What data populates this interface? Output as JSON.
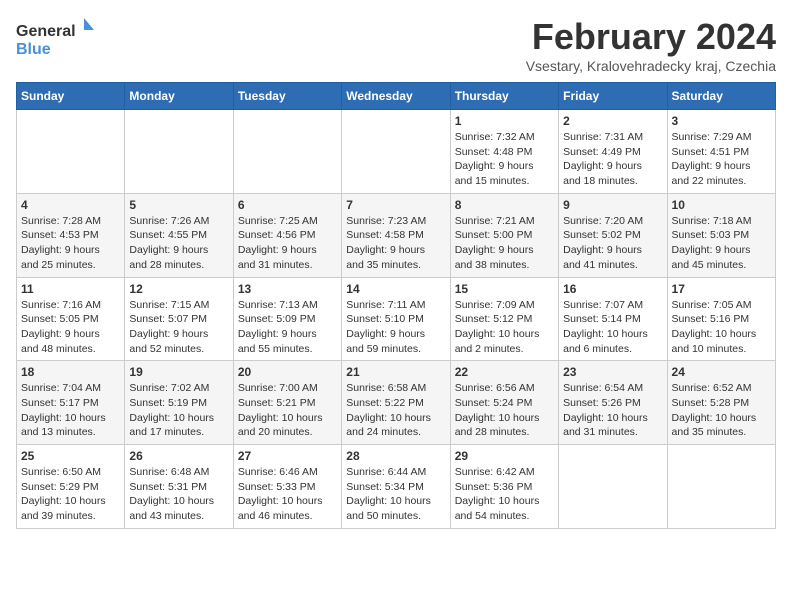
{
  "logo": {
    "line1": "General",
    "line2": "Blue"
  },
  "title": "February 2024",
  "subtitle": "Vsestary, Kralovehradecky kraj, Czechia",
  "days_of_week": [
    "Sunday",
    "Monday",
    "Tuesday",
    "Wednesday",
    "Thursday",
    "Friday",
    "Saturday"
  ],
  "weeks": [
    [
      {
        "day": "",
        "info": ""
      },
      {
        "day": "",
        "info": ""
      },
      {
        "day": "",
        "info": ""
      },
      {
        "day": "",
        "info": ""
      },
      {
        "day": "1",
        "info": "Sunrise: 7:32 AM\nSunset: 4:48 PM\nDaylight: 9 hours\nand 15 minutes."
      },
      {
        "day": "2",
        "info": "Sunrise: 7:31 AM\nSunset: 4:49 PM\nDaylight: 9 hours\nand 18 minutes."
      },
      {
        "day": "3",
        "info": "Sunrise: 7:29 AM\nSunset: 4:51 PM\nDaylight: 9 hours\nand 22 minutes."
      }
    ],
    [
      {
        "day": "4",
        "info": "Sunrise: 7:28 AM\nSunset: 4:53 PM\nDaylight: 9 hours\nand 25 minutes."
      },
      {
        "day": "5",
        "info": "Sunrise: 7:26 AM\nSunset: 4:55 PM\nDaylight: 9 hours\nand 28 minutes."
      },
      {
        "day": "6",
        "info": "Sunrise: 7:25 AM\nSunset: 4:56 PM\nDaylight: 9 hours\nand 31 minutes."
      },
      {
        "day": "7",
        "info": "Sunrise: 7:23 AM\nSunset: 4:58 PM\nDaylight: 9 hours\nand 35 minutes."
      },
      {
        "day": "8",
        "info": "Sunrise: 7:21 AM\nSunset: 5:00 PM\nDaylight: 9 hours\nand 38 minutes."
      },
      {
        "day": "9",
        "info": "Sunrise: 7:20 AM\nSunset: 5:02 PM\nDaylight: 9 hours\nand 41 minutes."
      },
      {
        "day": "10",
        "info": "Sunrise: 7:18 AM\nSunset: 5:03 PM\nDaylight: 9 hours\nand 45 minutes."
      }
    ],
    [
      {
        "day": "11",
        "info": "Sunrise: 7:16 AM\nSunset: 5:05 PM\nDaylight: 9 hours\nand 48 minutes."
      },
      {
        "day": "12",
        "info": "Sunrise: 7:15 AM\nSunset: 5:07 PM\nDaylight: 9 hours\nand 52 minutes."
      },
      {
        "day": "13",
        "info": "Sunrise: 7:13 AM\nSunset: 5:09 PM\nDaylight: 9 hours\nand 55 minutes."
      },
      {
        "day": "14",
        "info": "Sunrise: 7:11 AM\nSunset: 5:10 PM\nDaylight: 9 hours\nand 59 minutes."
      },
      {
        "day": "15",
        "info": "Sunrise: 7:09 AM\nSunset: 5:12 PM\nDaylight: 10 hours\nand 2 minutes."
      },
      {
        "day": "16",
        "info": "Sunrise: 7:07 AM\nSunset: 5:14 PM\nDaylight: 10 hours\nand 6 minutes."
      },
      {
        "day": "17",
        "info": "Sunrise: 7:05 AM\nSunset: 5:16 PM\nDaylight: 10 hours\nand 10 minutes."
      }
    ],
    [
      {
        "day": "18",
        "info": "Sunrise: 7:04 AM\nSunset: 5:17 PM\nDaylight: 10 hours\nand 13 minutes."
      },
      {
        "day": "19",
        "info": "Sunrise: 7:02 AM\nSunset: 5:19 PM\nDaylight: 10 hours\nand 17 minutes."
      },
      {
        "day": "20",
        "info": "Sunrise: 7:00 AM\nSunset: 5:21 PM\nDaylight: 10 hours\nand 20 minutes."
      },
      {
        "day": "21",
        "info": "Sunrise: 6:58 AM\nSunset: 5:22 PM\nDaylight: 10 hours\nand 24 minutes."
      },
      {
        "day": "22",
        "info": "Sunrise: 6:56 AM\nSunset: 5:24 PM\nDaylight: 10 hours\nand 28 minutes."
      },
      {
        "day": "23",
        "info": "Sunrise: 6:54 AM\nSunset: 5:26 PM\nDaylight: 10 hours\nand 31 minutes."
      },
      {
        "day": "24",
        "info": "Sunrise: 6:52 AM\nSunset: 5:28 PM\nDaylight: 10 hours\nand 35 minutes."
      }
    ],
    [
      {
        "day": "25",
        "info": "Sunrise: 6:50 AM\nSunset: 5:29 PM\nDaylight: 10 hours\nand 39 minutes."
      },
      {
        "day": "26",
        "info": "Sunrise: 6:48 AM\nSunset: 5:31 PM\nDaylight: 10 hours\nand 43 minutes."
      },
      {
        "day": "27",
        "info": "Sunrise: 6:46 AM\nSunset: 5:33 PM\nDaylight: 10 hours\nand 46 minutes."
      },
      {
        "day": "28",
        "info": "Sunrise: 6:44 AM\nSunset: 5:34 PM\nDaylight: 10 hours\nand 50 minutes."
      },
      {
        "day": "29",
        "info": "Sunrise: 6:42 AM\nSunset: 5:36 PM\nDaylight: 10 hours\nand 54 minutes."
      },
      {
        "day": "",
        "info": ""
      },
      {
        "day": "",
        "info": ""
      }
    ]
  ]
}
